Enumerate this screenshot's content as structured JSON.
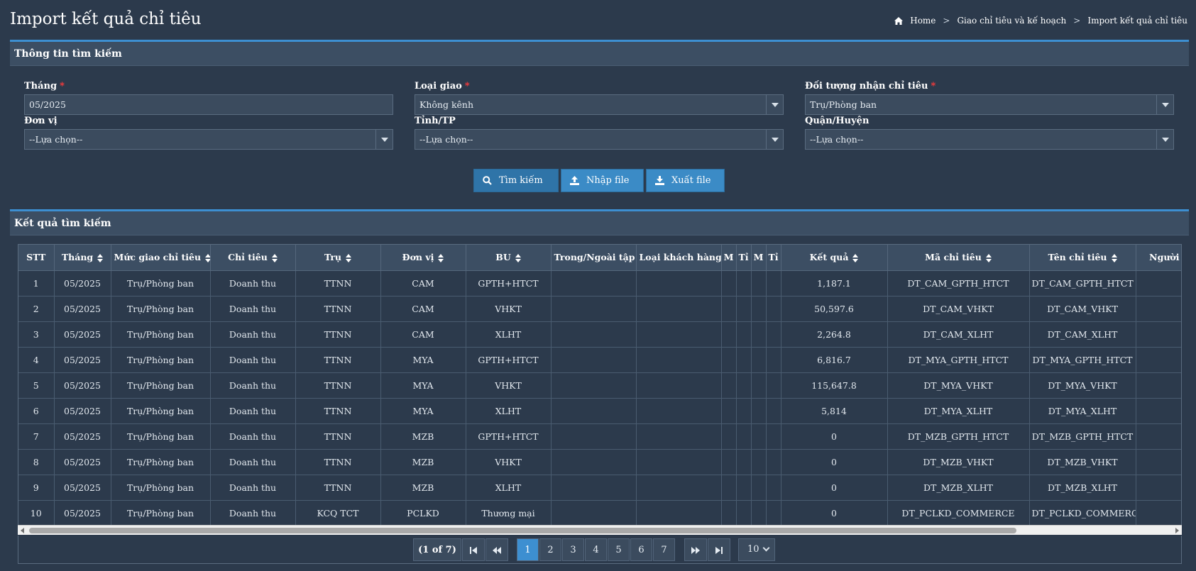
{
  "page": {
    "title": "Import kết quả chỉ tiêu",
    "breadcrumb": [
      "Home",
      "Giao chỉ tiêu và kế hoạch",
      "Import kết quả chỉ tiêu"
    ]
  },
  "search": {
    "title": "Thông tin tìm kiếm",
    "fields": {
      "thang": {
        "label": "Tháng",
        "value": "05/2025"
      },
      "loai_giao": {
        "label": "Loại giao",
        "value": "Không kênh"
      },
      "doi_tuong": {
        "label": "Đối tượng nhận chỉ tiêu",
        "value": "Trụ/Phòng ban"
      },
      "don_vi": {
        "label": "Đơn vị",
        "value": "--Lựa chọn--"
      },
      "tinh_tp": {
        "label": "Tỉnh/TP",
        "value": "--Lựa chọn--"
      },
      "quan_huyen": {
        "label": "Quận/Huyện",
        "value": "--Lựa chọn--"
      }
    },
    "buttons": {
      "search": "Tìm kiếm",
      "import": "Nhập file",
      "export": "Xuất file"
    }
  },
  "results": {
    "title": "Kết quả tìm kiếm",
    "columns": [
      "STT",
      "Tháng",
      "Mức giao chỉ tiêu",
      "Chỉ tiêu",
      "Trụ",
      "Đơn vị",
      "BU",
      "Trong/Ngoài tập đ",
      "Loại khách hàng",
      "M",
      "Tỉ",
      "M",
      "Tỉ",
      "Kết quả",
      "Mã chỉ tiêu",
      "Tên chỉ tiêu",
      "Người"
    ],
    "rows": [
      [
        "1",
        "05/2025",
        "Trụ/Phòng ban",
        "Doanh thu",
        "TTNN",
        "CAM",
        "GPTH+HTCT",
        "",
        "",
        "",
        "",
        "",
        "",
        "1,187.1",
        "DT_CAM_GPTH_HTCT",
        "DT_CAM_GPTH_HTCT",
        ""
      ],
      [
        "2",
        "05/2025",
        "Trụ/Phòng ban",
        "Doanh thu",
        "TTNN",
        "CAM",
        "VHKT",
        "",
        "",
        "",
        "",
        "",
        "",
        "50,597.6",
        "DT_CAM_VHKT",
        "DT_CAM_VHKT",
        ""
      ],
      [
        "3",
        "05/2025",
        "Trụ/Phòng ban",
        "Doanh thu",
        "TTNN",
        "CAM",
        "XLHT",
        "",
        "",
        "",
        "",
        "",
        "",
        "2,264.8",
        "DT_CAM_XLHT",
        "DT_CAM_XLHT",
        ""
      ],
      [
        "4",
        "05/2025",
        "Trụ/Phòng ban",
        "Doanh thu",
        "TTNN",
        "MYA",
        "GPTH+HTCT",
        "",
        "",
        "",
        "",
        "",
        "",
        "6,816.7",
        "DT_MYA_GPTH_HTCT",
        "DT_MYA_GPTH_HTCT",
        ""
      ],
      [
        "5",
        "05/2025",
        "Trụ/Phòng ban",
        "Doanh thu",
        "TTNN",
        "MYA",
        "VHKT",
        "",
        "",
        "",
        "",
        "",
        "",
        "115,647.8",
        "DT_MYA_VHKT",
        "DT_MYA_VHKT",
        ""
      ],
      [
        "6",
        "05/2025",
        "Trụ/Phòng ban",
        "Doanh thu",
        "TTNN",
        "MYA",
        "XLHT",
        "",
        "",
        "",
        "",
        "",
        "",
        "5,814",
        "DT_MYA_XLHT",
        "DT_MYA_XLHT",
        ""
      ],
      [
        "7",
        "05/2025",
        "Trụ/Phòng ban",
        "Doanh thu",
        "TTNN",
        "MZB",
        "GPTH+HTCT",
        "",
        "",
        "",
        "",
        "",
        "",
        "0",
        "DT_MZB_GPTH_HTCT",
        "DT_MZB_GPTH_HTCT",
        ""
      ],
      [
        "8",
        "05/2025",
        "Trụ/Phòng ban",
        "Doanh thu",
        "TTNN",
        "MZB",
        "VHKT",
        "",
        "",
        "",
        "",
        "",
        "",
        "0",
        "DT_MZB_VHKT",
        "DT_MZB_VHKT",
        ""
      ],
      [
        "9",
        "05/2025",
        "Trụ/Phòng ban",
        "Doanh thu",
        "TTNN",
        "MZB",
        "XLHT",
        "",
        "",
        "",
        "",
        "",
        "",
        "0",
        "DT_MZB_XLHT",
        "DT_MZB_XLHT",
        ""
      ],
      [
        "10",
        "05/2025",
        "Trụ/Phòng ban",
        "Doanh thu",
        "KCQ TCT",
        "PCLKD",
        "Thương mại",
        "",
        "",
        "",
        "",
        "",
        "",
        "0",
        "DT_PCLKD_COMMERCE",
        "DT_PCLKD_COMMERCE",
        ""
      ]
    ]
  },
  "pagination": {
    "info": "(1 of 7)",
    "pages": [
      "1",
      "2",
      "3",
      "4",
      "5",
      "6",
      "7"
    ],
    "current": "1",
    "page_size": "10"
  }
}
